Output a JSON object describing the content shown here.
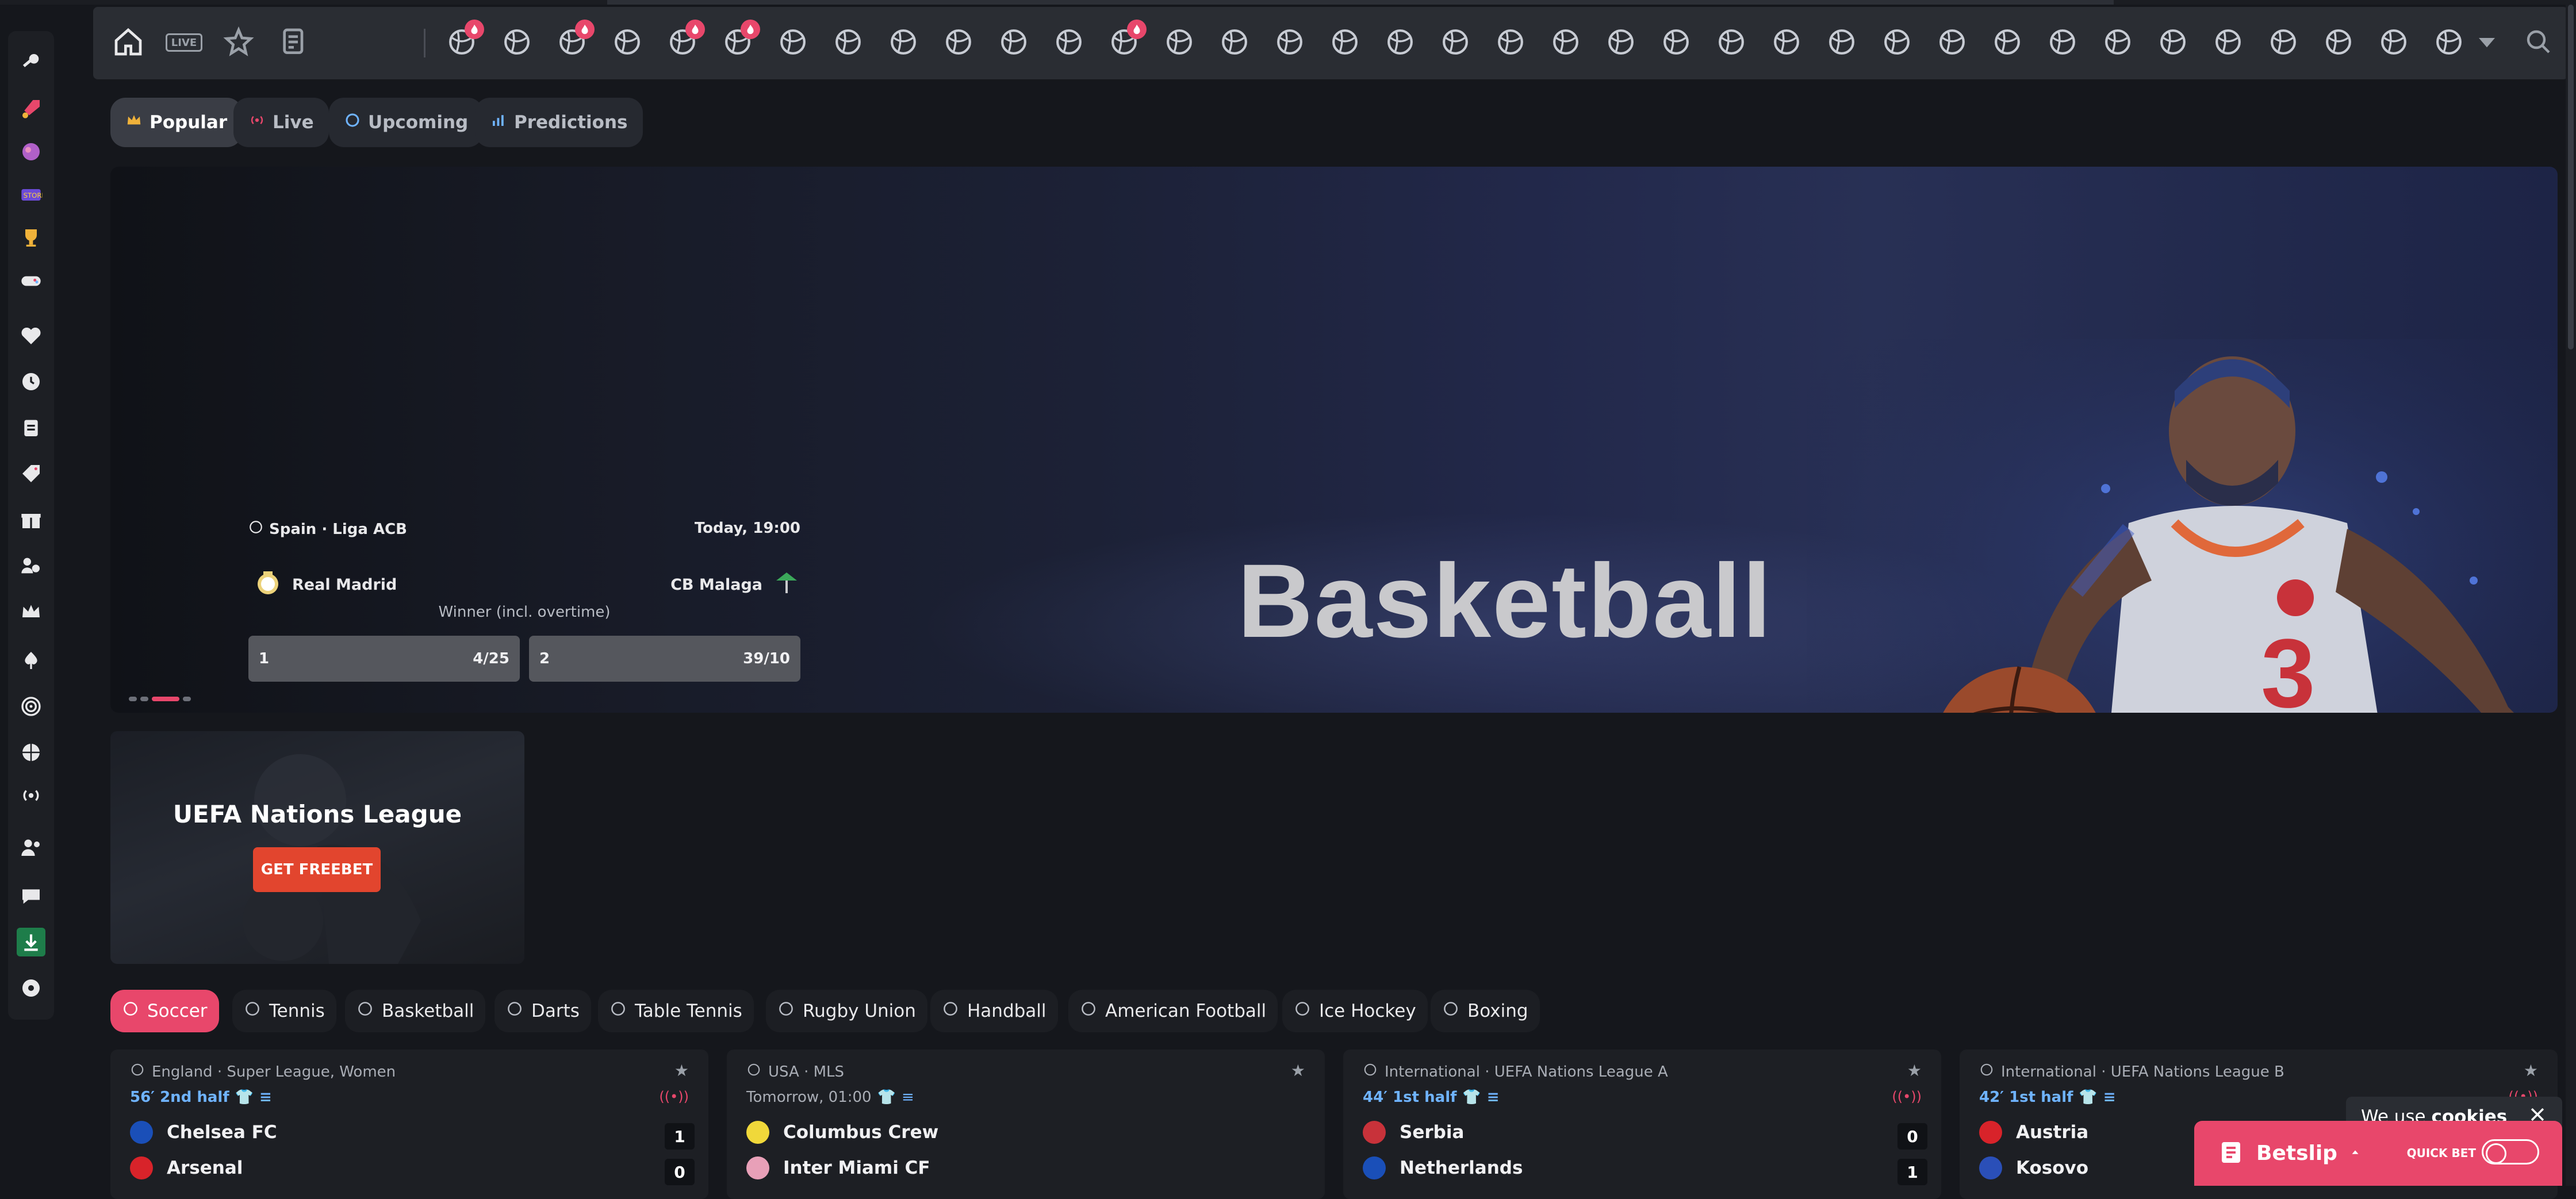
{
  "colors": {
    "accent": "#e8476b",
    "bg": "#15171c",
    "panel": "#1d1f24",
    "live_blue": "#6fb3ff",
    "cta": "#e2452e"
  },
  "sidebar": {
    "items": [
      "key-icon",
      "rocket-icon",
      "planet-icon",
      "store-icon",
      "trophy-icon",
      "gamepad-icon",
      "heart-icon",
      "clock-icon",
      "clipboard-icon",
      "tag-icon",
      "gift-icon",
      "users-icon",
      "crown-icon",
      "spade-icon",
      "target-icon",
      "basketball-icon",
      "broadcast-icon",
      "user-group-icon",
      "chat-icon",
      "download-icon",
      "ball-icon"
    ]
  },
  "sportsbar": {
    "live_label": "LIVE",
    "icons": [
      "home-icon",
      "live-icon",
      "star-icon",
      "coupon-icon",
      "soccer-icon",
      "target-icon",
      "tennis-icon",
      "hockey-icon",
      "basketball-icon",
      "soccer-virtual-icon",
      "golf-icon",
      "baseball-icon",
      "rugby-icon",
      "volleyball-icon",
      "mma-icon",
      "valorant-icon",
      "runner-icon",
      "dota-icon",
      "chess-icon",
      "flag-icon",
      "horse-icon",
      "ufc-icon",
      "volta-icon",
      "penalty-icon",
      "snooker-icon",
      "cricket-icon",
      "fist-icon",
      "player-icon",
      "futsal-icon",
      "efootball-icon",
      "paddle-icon",
      "rugby-ball-icon",
      "badminton-icon",
      "card-icon",
      "american-football-icon",
      "cycle-icon",
      "aussie-icon",
      "bowling-icon",
      "phone-icon",
      "racket-icon",
      "esports-icon"
    ]
  },
  "chips": [
    {
      "label": "Popular",
      "icon": "crown-icon"
    },
    {
      "label": "Live",
      "icon": "broadcast-icon"
    },
    {
      "label": "Upcoming",
      "icon": "clock-icon"
    },
    {
      "label": "Predictions",
      "icon": "chart-icon"
    }
  ],
  "hero": {
    "title": "Basketball",
    "match": {
      "league": "Spain · Liga ACB",
      "time": "Today, 19:00",
      "home": "Real Madrid",
      "away": "CB Malaga",
      "market": "Winner (incl. overtime)",
      "odds": [
        {
          "label": "1",
          "value": "4/25"
        },
        {
          "label": "2",
          "value": "39/10"
        }
      ]
    }
  },
  "promo": {
    "title": "UEFA Nations League",
    "button": "GET FREEBET"
  },
  "sport_tabs": [
    "Soccer",
    "Tennis",
    "Basketball",
    "Darts",
    "Table Tennis",
    "Rugby Union",
    "Handball",
    "American Football",
    "Ice Hockey",
    "Boxing"
  ],
  "events": [
    {
      "league": "England · Super League, Women",
      "status": "56′ 2nd half",
      "live": true,
      "home": "Chelsea FC",
      "away": "Arsenal",
      "home_score": "1",
      "away_score": "0"
    },
    {
      "league": "USA · MLS",
      "status": "Tomorrow, 01:00",
      "live": false,
      "home": "Columbus Crew",
      "away": "Inter Miami CF",
      "home_score": "",
      "away_score": ""
    },
    {
      "league": "International · UEFA Nations League A",
      "status": "44′ 1st half",
      "live": true,
      "home": "Serbia",
      "away": "Netherlands",
      "home_score": "0",
      "away_score": "1"
    },
    {
      "league": "International · UEFA Nations League B",
      "status": "42′ 1st half",
      "live": true,
      "home": "Austria",
      "away": "Kosovo",
      "home_score": "",
      "away_score": ""
    }
  ],
  "cookies": {
    "prefix": "We use",
    "bold": "cookies"
  },
  "betslip": {
    "label": "Betslip",
    "quick": "QUICK BET"
  }
}
